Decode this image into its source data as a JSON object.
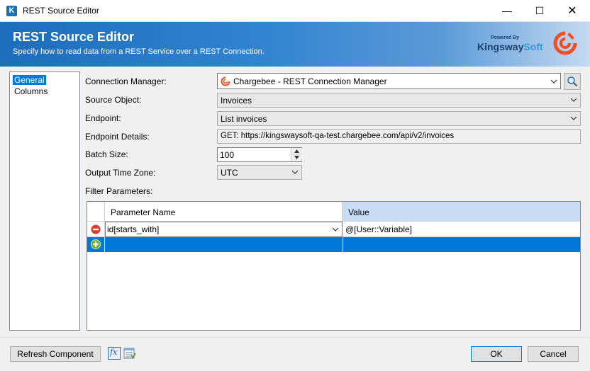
{
  "window": {
    "title": "REST Source Editor",
    "app_icon_letter": "K",
    "minimize_glyph": "—",
    "maximize_glyph": "☐",
    "close_glyph": "✕"
  },
  "banner": {
    "title": "REST Source Editor",
    "subtitle": "Specify how to read data from a REST Service over a REST Connection.",
    "logo_powered": "Powered By",
    "logo_brand_main": "Kingsway",
    "logo_brand_soft": "Soft"
  },
  "nav": {
    "items": [
      {
        "label": "General",
        "selected": true
      },
      {
        "label": "Columns",
        "selected": false
      }
    ]
  },
  "form": {
    "connection_manager": {
      "label": "Connection Manager:",
      "value": "Chargebee - REST Connection Manager"
    },
    "source_object": {
      "label": "Source Object:",
      "value": "Invoices"
    },
    "endpoint": {
      "label": "Endpoint:",
      "value": "List invoices"
    },
    "endpoint_details": {
      "label": "Endpoint Details:",
      "value": "GET: https://kingswaysoft-qa-test.chargebee.com/api/v2/invoices"
    },
    "batch_size": {
      "label": "Batch Size:",
      "value": "100"
    },
    "output_time_zone": {
      "label": "Output Time Zone:",
      "value": "UTC"
    },
    "filter_parameters": {
      "label": "Filter Parameters:"
    }
  },
  "grid": {
    "columns": [
      "Parameter Name",
      "Value"
    ],
    "rows": [
      {
        "name": "id[starts_with]",
        "value": "@[User::Variable]"
      }
    ]
  },
  "footer": {
    "refresh_label": "Refresh Component",
    "fx_label": "fx",
    "ok_label": "OK",
    "cancel_label": "Cancel"
  },
  "colors": {
    "accent": "#0078d7",
    "banner": "#1d6dba",
    "chargebee_orange": "#f04e23",
    "remove_red": "#d93a2a",
    "add_green": "#6ab023"
  }
}
